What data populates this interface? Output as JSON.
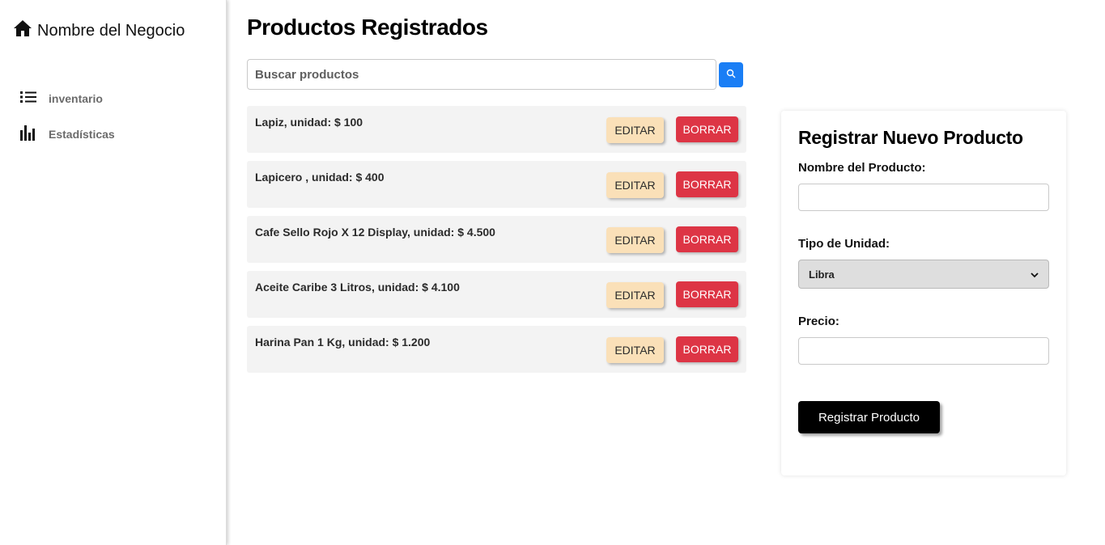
{
  "sidebar": {
    "brand": "Nombre del Negocio",
    "brand_icon": "home-icon",
    "items": [
      {
        "label": "inventario",
        "icon": "list-icon"
      },
      {
        "label": "Estadísticas",
        "icon": "bar-chart-icon"
      }
    ]
  },
  "main": {
    "title": "Productos Registrados",
    "search": {
      "placeholder": "Buscar productos",
      "button_icon": "search-icon"
    },
    "edit_label": "EDITAR",
    "delete_label": "BORRAR",
    "products": [
      "Lapiz, unidad: $ 100",
      "Lapicero , unidad: $ 400",
      "Cafe Sello Rojo X 12 Display, unidad: $ 4.500",
      "Aceite Caribe 3 Litros, unidad: $ 4.100",
      "Harina Pan 1 Kg, unidad: $ 1.200"
    ]
  },
  "form": {
    "title": "Registrar Nuevo Producto",
    "name_label": "Nombre del Producto:",
    "name_value": "",
    "unit_label": "Tipo de Unidad:",
    "unit_selected": "Libra",
    "price_label": "Precio:",
    "price_value": "",
    "submit_label": "Registrar Producto"
  },
  "colors": {
    "accent_blue": "#1a7ef5",
    "edit_button": "#fae0b8",
    "delete_button": "#dd3545",
    "submit_button": "#000000"
  }
}
